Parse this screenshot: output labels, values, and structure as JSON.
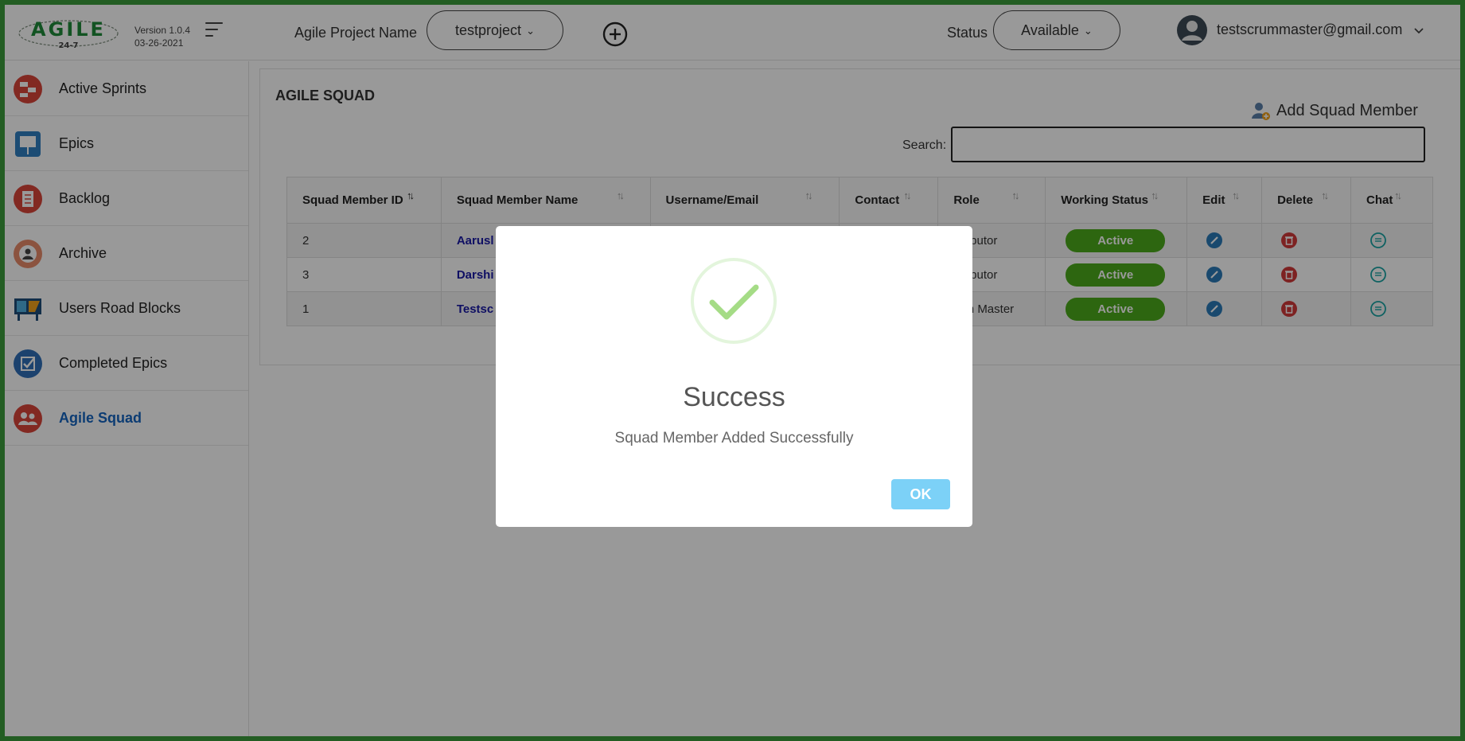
{
  "header": {
    "logo_text": "AGILE",
    "logo_sub": "24-7",
    "version": "Version 1.0.4",
    "date": "03-26-2021",
    "project_label": "Agile Project Name",
    "project_value": "testproject",
    "status_label": "Status",
    "status_value": "Available",
    "user_email": "testscrummaster@gmail.com"
  },
  "sidebar": {
    "items": [
      {
        "label": "Active Sprints",
        "icon": "active-sprints-icon"
      },
      {
        "label": "Epics",
        "icon": "epics-icon"
      },
      {
        "label": "Backlog",
        "icon": "backlog-icon"
      },
      {
        "label": "Archive",
        "icon": "archive-icon"
      },
      {
        "label": "Users Road Blocks",
        "icon": "road-blocks-icon"
      },
      {
        "label": "Completed Epics",
        "icon": "completed-epics-icon"
      },
      {
        "label": "Agile Squad",
        "icon": "agile-squad-icon",
        "active": true
      }
    ]
  },
  "main": {
    "title": "AGILE SQUAD",
    "add_member_label": "Add Squad Member",
    "search_label": "Search:",
    "search_value": "",
    "columns": [
      "Squad Member ID",
      "Squad Member Name",
      "Username/Email",
      "Contact",
      "Role",
      "Working Status",
      "Edit",
      "Delete",
      "Chat"
    ],
    "rows": [
      {
        "id": "2",
        "name": "Aarusl",
        "email": "",
        "contact": "",
        "role": "ntributor",
        "status": "Active"
      },
      {
        "id": "3",
        "name": "Darshi",
        "email": "",
        "contact": "",
        "role": "ntributor",
        "status": "Active"
      },
      {
        "id": "1",
        "name": "Testsc",
        "email": "",
        "contact": "",
        "role": "rum Master",
        "status": "Active"
      }
    ]
  },
  "modal": {
    "title": "Success",
    "message": "Squad Member Added Successfully",
    "ok_label": "OK"
  },
  "colors": {
    "active_badge": "#4caa1c",
    "link": "#1a1aa6",
    "ok_button": "#7cd1f7",
    "frame": "#3b9c3b"
  }
}
